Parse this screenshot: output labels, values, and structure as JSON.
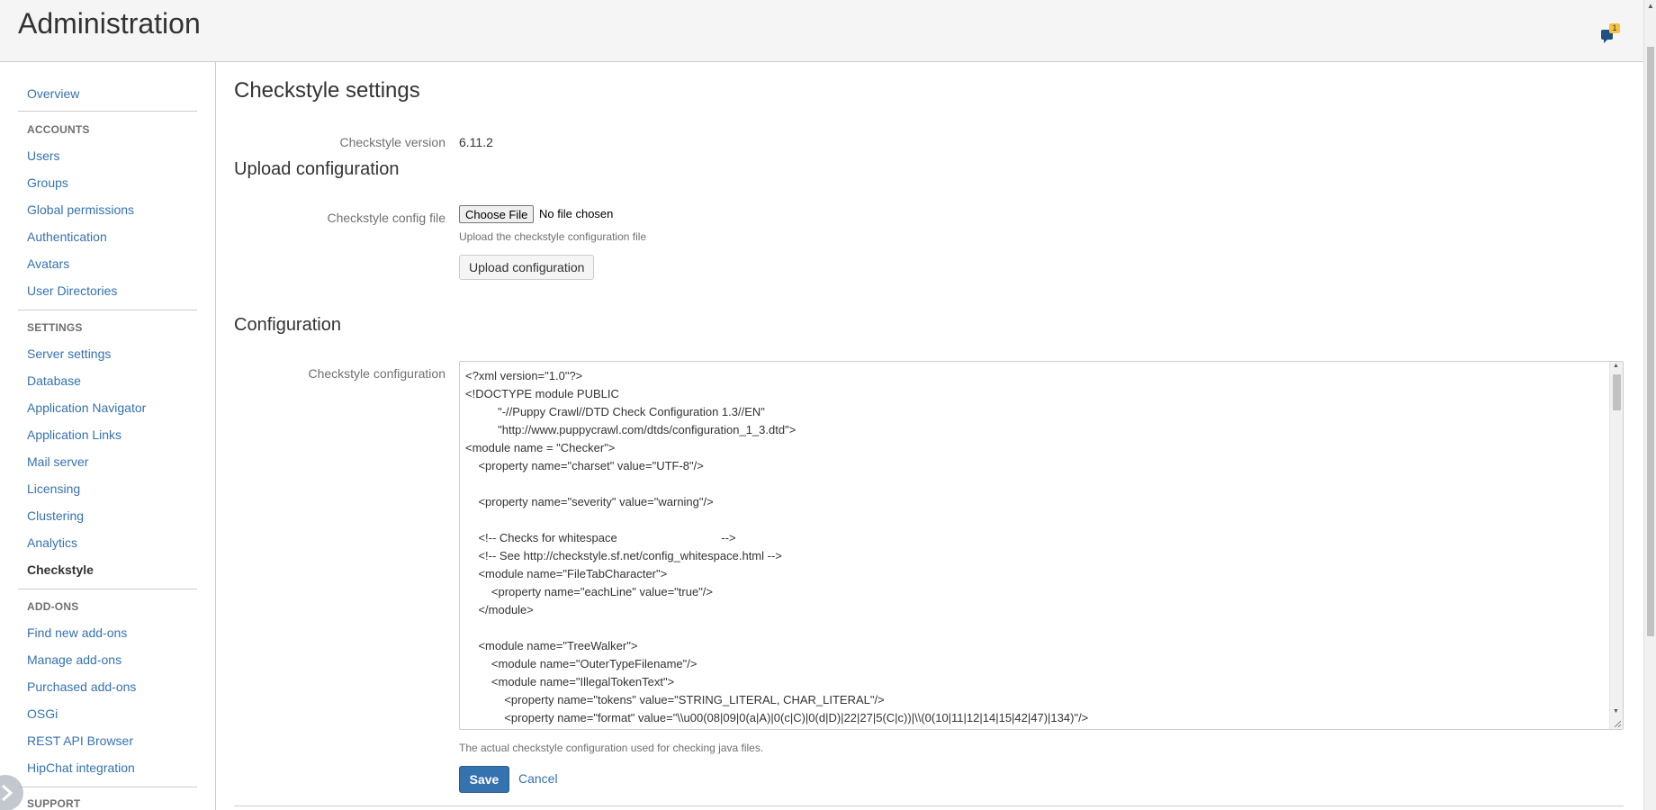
{
  "header": {
    "title": "Administration",
    "notification_count": "1"
  },
  "sidebar": {
    "overview": "Overview",
    "accounts_heading": "ACCOUNTS",
    "accounts": [
      "Users",
      "Groups",
      "Global permissions",
      "Authentication",
      "Avatars",
      "User Directories"
    ],
    "settings_heading": "SETTINGS",
    "settings": [
      "Server settings",
      "Database",
      "Application Navigator",
      "Application Links",
      "Mail server",
      "Licensing",
      "Clustering",
      "Analytics",
      "Checkstyle"
    ],
    "active_item": "Checkstyle",
    "addons_heading": "ADD-ONS",
    "addons": [
      "Find new add-ons",
      "Manage add-ons",
      "Purchased add-ons",
      "OSGi",
      "REST API Browser",
      "HipChat integration"
    ],
    "support_heading": "SUPPORT"
  },
  "main": {
    "title": "Checkstyle settings",
    "version_label": "Checkstyle version",
    "version_value": "6.11.2",
    "upload_heading": "Upload configuration",
    "config_file_label": "Checkstyle config file",
    "choose_file_label": "Choose File",
    "no_file_text": "No file chosen",
    "upload_help": "Upload the checkstyle configuration file",
    "upload_button": "Upload configuration",
    "configuration_heading": "Configuration",
    "config_label": "Checkstyle configuration",
    "config_text": "<?xml version=\"1.0\"?>\n<!DOCTYPE module PUBLIC\n          \"-//Puppy Crawl//DTD Check Configuration 1.3//EN\"\n          \"http://www.puppycrawl.com/dtds/configuration_1_3.dtd\">\n<module name = \"Checker\">\n    <property name=\"charset\" value=\"UTF-8\"/>\n\n    <property name=\"severity\" value=\"warning\"/>\n\n    <!-- Checks for whitespace                                -->\n    <!-- See http://checkstyle.sf.net/config_whitespace.html -->\n    <module name=\"FileTabCharacter\">\n        <property name=\"eachLine\" value=\"true\"/>\n    </module>\n\n    <module name=\"TreeWalker\">\n        <module name=\"OuterTypeFilename\"/>\n        <module name=\"IllegalTokenText\">\n            <property name=\"tokens\" value=\"STRING_LITERAL, CHAR_LITERAL\"/>\n            <property name=\"format\" value=\"\\\\u00(08|09|0(a|A)|0(c|C)|0(d|D)|22|27|5(C|c))|\\\\(0(10|11|12|14|15|42|47)|134)\"/>",
    "config_help": "The actual checkstyle configuration used for checking java files.",
    "save_button": "Save",
    "cancel_link": "Cancel"
  }
}
